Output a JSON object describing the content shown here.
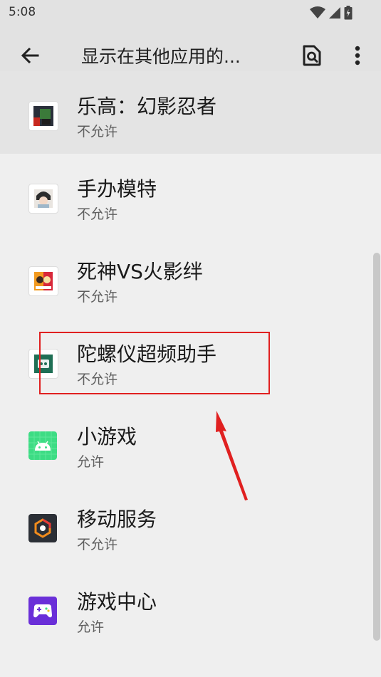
{
  "status_bar": {
    "time": "5:08"
  },
  "app_bar": {
    "title": "显示在其他应用的..."
  },
  "apps": [
    {
      "name": "乐高：幻影忍者",
      "status": "不允许",
      "icon": "lego-ninjago-app-icon"
    },
    {
      "name": "手办模特",
      "status": "不允许",
      "icon": "figure-model-app-icon"
    },
    {
      "name": "死神VS火影绊",
      "status": "不允许",
      "icon": "bleach-vs-naruto-app-icon"
    },
    {
      "name": "陀螺仪超频助手",
      "status": "不允许",
      "icon": "gyroscope-helper-app-icon"
    },
    {
      "name": "小游戏",
      "status": "允许",
      "icon": "android-app-icon"
    },
    {
      "name": "移动服务",
      "status": "不允许",
      "icon": "mobile-services-app-icon"
    },
    {
      "name": "游戏中心",
      "status": "允许",
      "icon": "game-center-app-icon"
    }
  ],
  "colors": {
    "annotation": "#e02020",
    "background": "#efefef",
    "app_bar": "#e2e2e2"
  }
}
